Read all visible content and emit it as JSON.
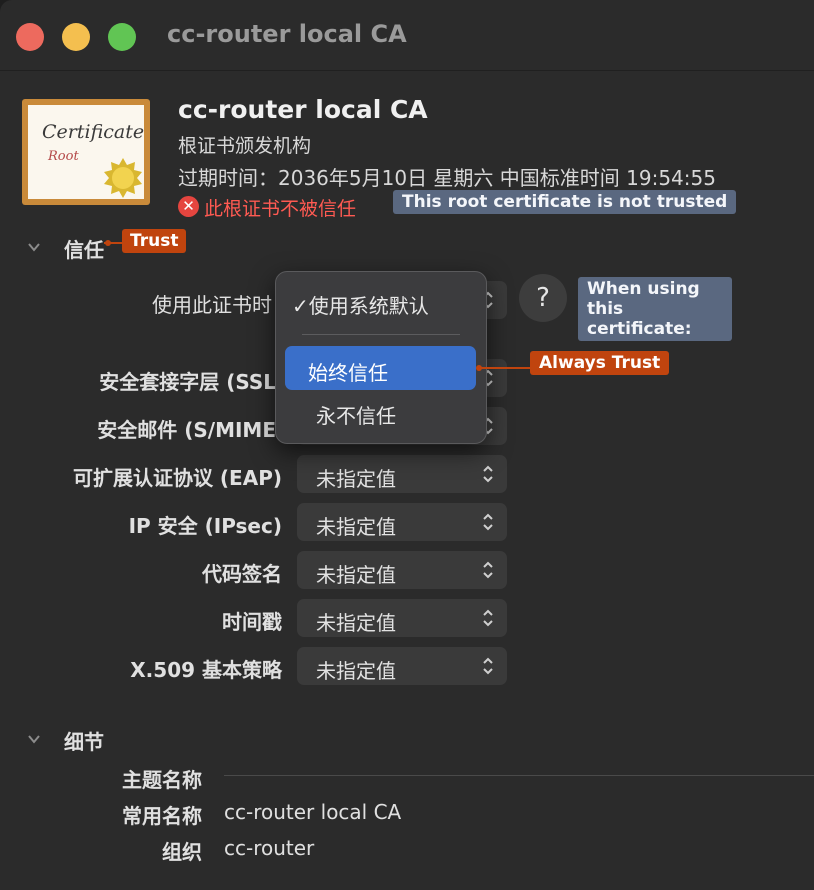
{
  "window": {
    "title": "cc-router local CA"
  },
  "certificate": {
    "icon_text": "Certificate",
    "icon_subtext": "Root",
    "name": "cc-router local CA",
    "kind": "根证书颁发机构",
    "expiry": "过期时间：2036年5月10日 星期六 中国标准时间 19:54:55",
    "warning": "此根证书不被信任"
  },
  "annotations": {
    "not_trusted": "This root certificate is not trusted",
    "trust": "Trust",
    "when_using_line1": "When using",
    "when_using_line2": "this certificate:",
    "always_trust": "Always Trust"
  },
  "trust_section": {
    "label": "信任",
    "when_using_label": "使用此证书时",
    "help": "?",
    "menu": {
      "default_option": "✓使用系统默认",
      "always_trust": "始终信任",
      "never_trust": "永不信任"
    },
    "rows": [
      {
        "label": "安全套接字层 (SSL",
        "value": ""
      },
      {
        "label": "安全邮件 (S/MIME",
        "value": ""
      },
      {
        "label": "可扩展认证协议 (EAP)",
        "value": "未指定值"
      },
      {
        "label": "IP 安全 (IPsec)",
        "value": "未指定值"
      },
      {
        "label": "代码签名",
        "value": "未指定值"
      },
      {
        "label": "时间戳",
        "value": "未指定值"
      },
      {
        "label": "X.509 基本策略",
        "value": "未指定值"
      }
    ]
  },
  "details_section": {
    "label": "细节",
    "subject_name_label": "主题名称",
    "common_name_label": "常用名称",
    "common_name_value": "cc-router local CA",
    "org_label": "组织",
    "org_value": "cc-router"
  },
  "colors": {
    "annotation_blue": "#5a6880",
    "annotation_orange": "#c0440e",
    "menu_highlight": "#3a6fc9",
    "warning_red": "#ff5a52"
  }
}
